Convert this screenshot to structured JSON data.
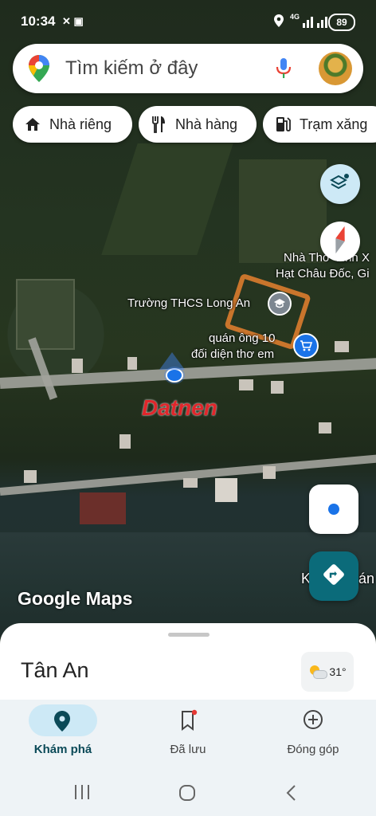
{
  "status_bar": {
    "time": "10:34",
    "battery": "89",
    "network": "4G"
  },
  "search": {
    "placeholder": "Tìm kiếm ở đây"
  },
  "chips": [
    {
      "label": "Nhà riêng",
      "icon": "home-icon"
    },
    {
      "label": "Nhà hàng",
      "icon": "restaurant-icon"
    },
    {
      "label": "Trạm xăng",
      "icon": "gas-station-icon"
    }
  ],
  "map_labels": {
    "church": "Nhà Thờ Vĩnh X",
    "church_line2": "Hạt Châu Đốc, Gi",
    "school": "Trường THCS Long An",
    "shop_line1": "quán ông 10",
    "shop_line2": "đối diện thơ em",
    "watermark": "Datnen",
    "google_logo": "Google Maps",
    "edge_label": "K",
    "edge_label2": "án"
  },
  "sheet": {
    "place": "Tân An",
    "temperature": "31°"
  },
  "bottom_nav": [
    {
      "label": "Khám phá",
      "icon": "explore-pin-icon",
      "active": true
    },
    {
      "label": "Đã lưu",
      "icon": "bookmark-icon",
      "active": false
    },
    {
      "label": "Đóng góp",
      "icon": "add-circle-icon",
      "active": false
    }
  ],
  "colors": {
    "accent": "#0b6b7a",
    "nav_pill": "#cde9f6",
    "watermark": "#e0262b"
  }
}
